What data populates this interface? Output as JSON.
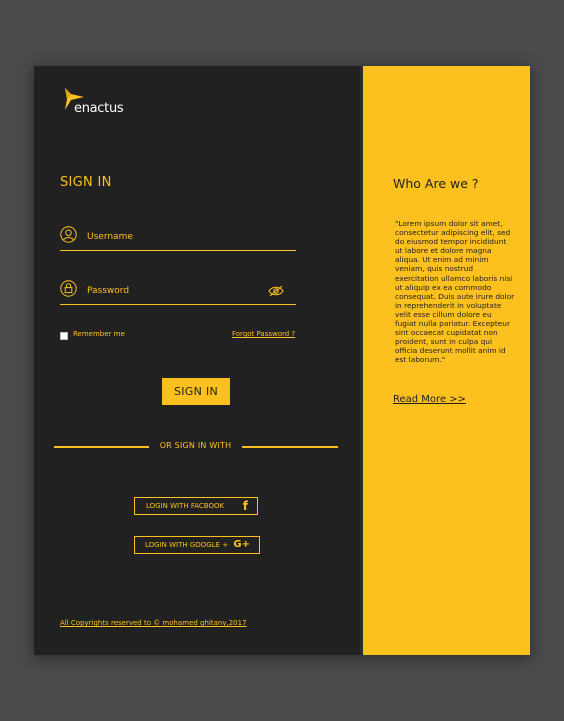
{
  "brand": {
    "logo_text": "enactus",
    "accent_color": "#fdc11f",
    "dark_color": "#212121",
    "background_color": "#4a4a4a"
  },
  "sign_in": {
    "title": "SIGN IN",
    "username_placeholder": "Username",
    "password_placeholder": "Password",
    "remember_label": "Remember me",
    "remember_checked": false,
    "forgot_label": "Forgot Password ?",
    "button_label": "SIGN IN",
    "divider_text": "OR SIGN IN WITH",
    "facebook_label": "LOGIN WITH FACBOOK",
    "facebook_icon": "f",
    "google_label": "LOGIN WITH GOOGLE +",
    "google_icon": "G+",
    "copyright": "All Copyrights reserved to © mohamed ghitany,2017"
  },
  "about": {
    "title": "Who Are we ?",
    "body": "\"Lorem ipsum dolor sit amet, consectetur adipiscing elit, sed do eiusmod tempor incididunt ut labore et dolore magna aliqua. Ut enim ad minim veniam, quis nostrud exercitation ullamco laboris nisi ut aliquip ex ea commodo consequat. Duis aute irure dolor in reprehenderit in voluptate velit esse cillum dolore eu fugiat nulla pariatur. Excepteur sint occaecat cupidatat non proident, sunt in culpa qui officia deserunt mollit anim id est laborum.\"",
    "read_more": "Read More >>"
  }
}
